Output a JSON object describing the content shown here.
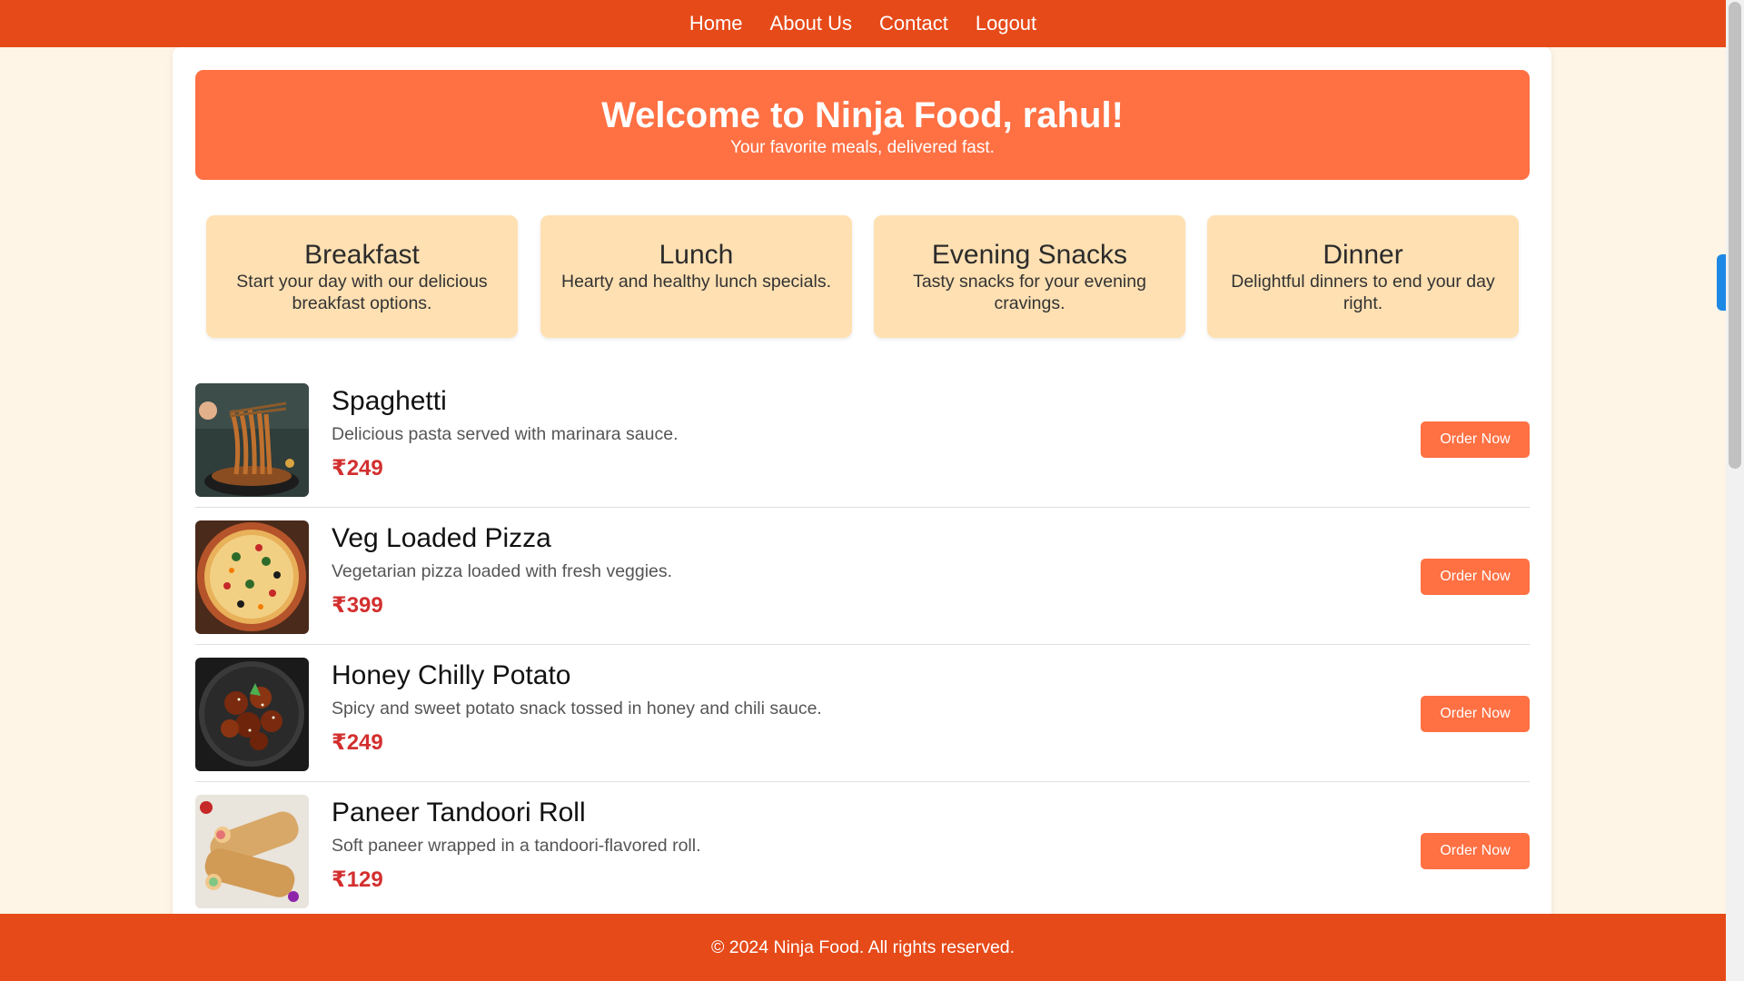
{
  "nav": {
    "items": [
      "Home",
      "About Us",
      "Contact",
      "Logout"
    ]
  },
  "hero": {
    "title": "Welcome to Ninja Food, rahul!",
    "subtitle": "Your favorite meals, delivered fast."
  },
  "categories": [
    {
      "title": "Breakfast",
      "desc": "Start your day with our delicious breakfast options."
    },
    {
      "title": "Lunch",
      "desc": "Hearty and healthy lunch specials."
    },
    {
      "title": "Evening Snacks",
      "desc": "Tasty snacks for your evening cravings."
    },
    {
      "title": "Dinner",
      "desc": "Delightful dinners to end your day right."
    }
  ],
  "menu": [
    {
      "name": "Spaghetti",
      "desc": "Delicious pasta served with marinara sauce.",
      "price": "₹249",
      "button": "Order Now",
      "image": "spaghetti-photo"
    },
    {
      "name": "Veg Loaded Pizza",
      "desc": "Vegetarian pizza loaded with fresh veggies.",
      "price": "₹399",
      "button": "Order Now",
      "image": "pizza-photo"
    },
    {
      "name": "Honey Chilly Potato",
      "desc": "Spicy and sweet potato snack tossed in honey and chili sauce.",
      "price": "₹249",
      "button": "Order Now",
      "image": "honey-chilly-potato-photo"
    },
    {
      "name": "Paneer Tandoori Roll",
      "desc": "Soft paneer wrapped in a tandoori-flavored roll.",
      "price": "₹129",
      "button": "Order Now",
      "image": "paneer-roll-photo"
    }
  ],
  "footer": {
    "text": "© 2024 Ninja Food. All rights reserved."
  },
  "colors": {
    "nav_bg": "#e64a19",
    "hero_bg": "#ff7043",
    "category_bg": "#ffe0b2",
    "page_bg": "#fff5e6",
    "price": "#d32f2f",
    "button": "#ff7043"
  }
}
